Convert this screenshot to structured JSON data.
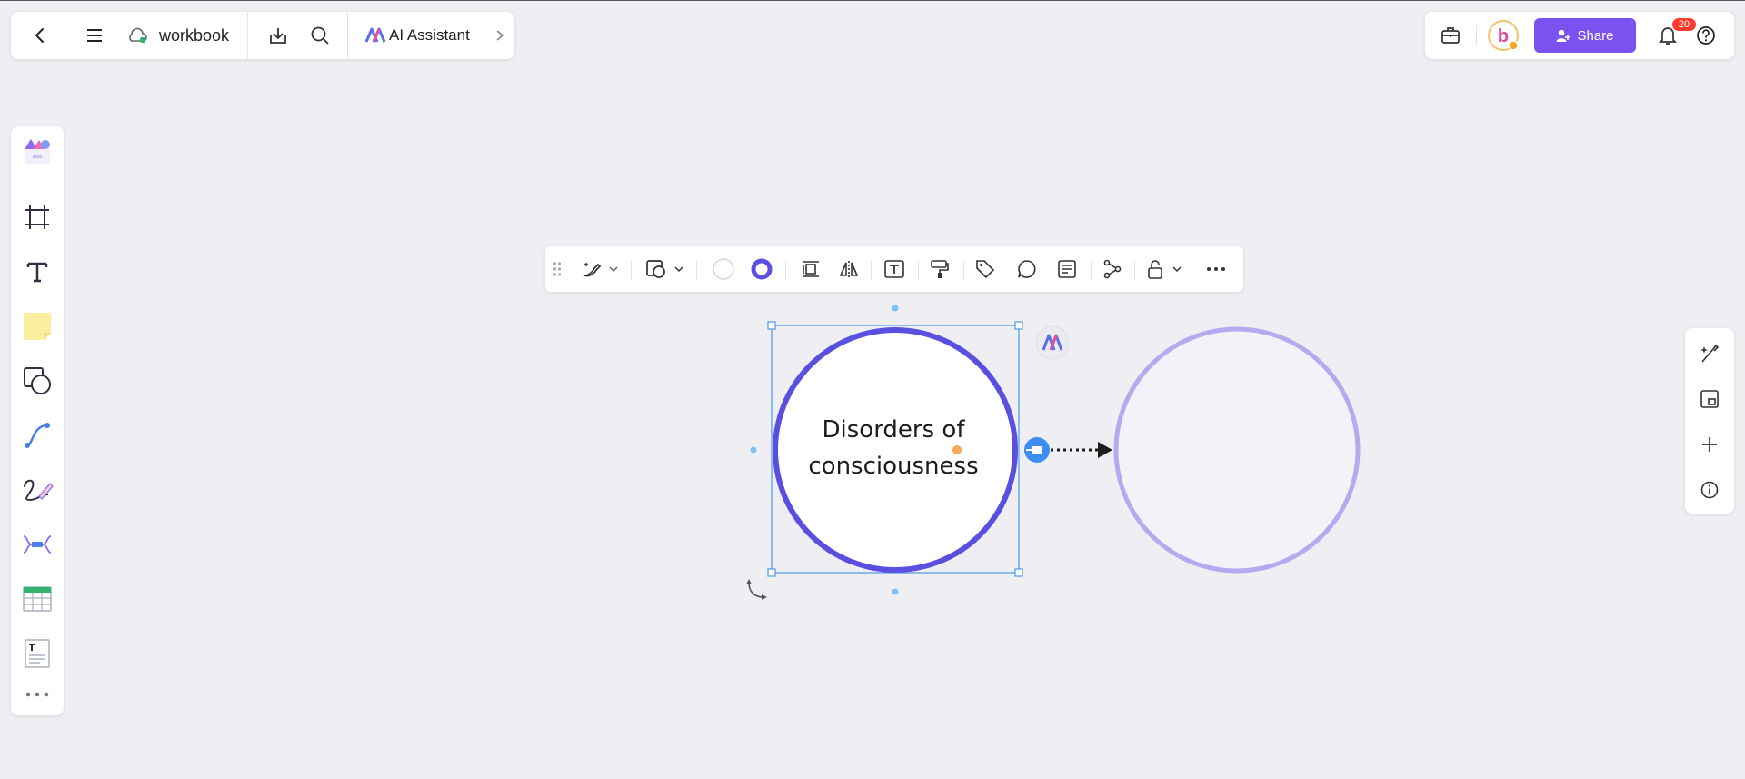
{
  "topbar": {
    "doc_title": "workbook",
    "ai_assistant_label": "AI Assistant"
  },
  "actions": {
    "share_label": "Share",
    "notification_count": "20"
  },
  "avatar": {
    "letter": "b"
  },
  "left_toolbar": {
    "items": [
      "templates",
      "frame",
      "text",
      "sticky-note",
      "shapes",
      "connector",
      "pen",
      "mind-map",
      "table",
      "document",
      "more"
    ]
  },
  "shape_toolbar": {
    "items": [
      "style-brush",
      "shape-type",
      "fill-color",
      "border-color",
      "align",
      "flip",
      "text",
      "format-painter",
      "tag",
      "comment",
      "note",
      "connection",
      "lock",
      "more"
    ]
  },
  "canvas": {
    "selected_shape_text_line1": "Disorders of",
    "selected_shape_text_line2": "consciousness",
    "primary_color": "#5b4fe0",
    "secondary_color": "#b5aaf0",
    "selection_color": "#4a9be8"
  },
  "right_toolbar": {
    "items": [
      "ai-magic",
      "minimap",
      "zoom-in",
      "info"
    ]
  }
}
